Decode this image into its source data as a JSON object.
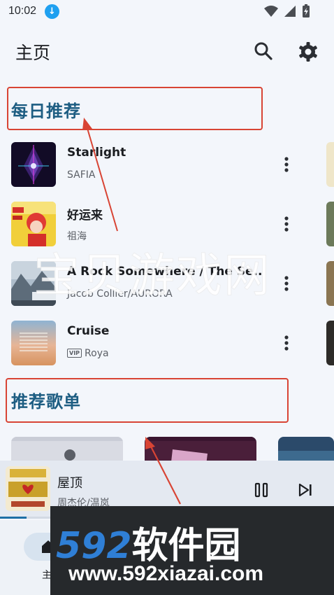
{
  "status_bar": {
    "time": "10:02",
    "download_badge": "↓",
    "icons": [
      "wifi-icon",
      "signal-icon",
      "battery-charging-icon"
    ]
  },
  "header": {
    "title": "主页",
    "icons": [
      "search-icon",
      "gear-icon"
    ]
  },
  "sections": {
    "daily": "每日推荐",
    "playlists": "推荐歌单"
  },
  "songs": [
    {
      "title": "Starlight",
      "artist": "SAFIA",
      "vip": ""
    },
    {
      "title": "好运来",
      "artist": "祖海",
      "vip": ""
    },
    {
      "title": "A Rock Somewhere / The Se..",
      "artist": "Jacob Collier/AURORA",
      "vip": ""
    },
    {
      "title": "Cruise",
      "artist": "Roya",
      "vip": "VIP"
    }
  ],
  "now_playing": {
    "title": "屋顶",
    "artist": "周杰伦/温岚",
    "progress": 0.08
  },
  "bottom_nav": {
    "home_label": "主页"
  },
  "watermarks": {
    "center": "宝贝游戏网",
    "banner_top_digits": "592",
    "banner_top_cn": "软件园",
    "banner_bottom": "www.592xiazai.com"
  },
  "colors": {
    "accent": "#1d5d82",
    "highlight_box": "#d84434",
    "background": "#f3f6fb"
  }
}
